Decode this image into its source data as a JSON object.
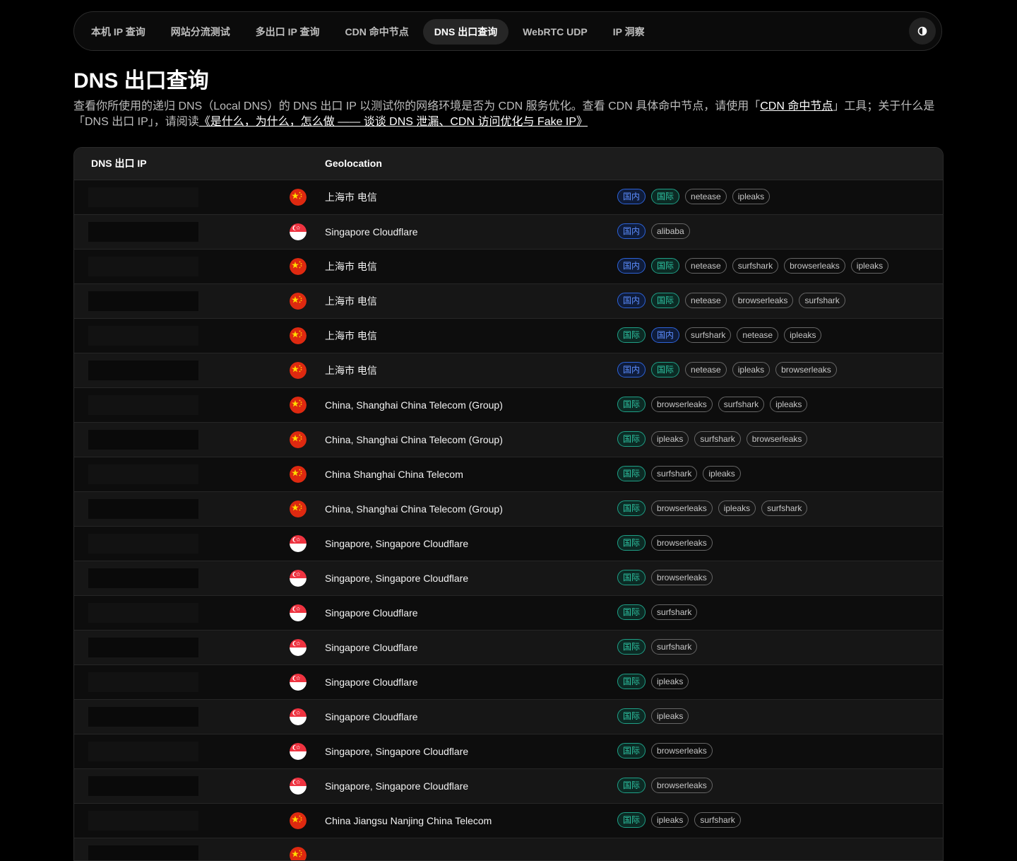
{
  "nav": {
    "tabs": [
      {
        "label": "本机 IP 查询",
        "active": false
      },
      {
        "label": "网站分流测试",
        "active": false
      },
      {
        "label": "多出口 IP 查询",
        "active": false
      },
      {
        "label": "CDN 命中节点",
        "active": false
      },
      {
        "label": "DNS 出口查询",
        "active": true
      },
      {
        "label": "WebRTC UDP",
        "active": false
      },
      {
        "label": "IP 洞察",
        "active": false
      }
    ],
    "theme_icon": "theme-toggle-icon"
  },
  "page": {
    "title": "DNS 出口查询",
    "desc_part1": "查看你所使用的递归 DNS（Local DNS）的 DNS 出口 IP 以测试你的网络环境是否为 CDN 服务优化。查看 CDN 具体命中节点，请使用「",
    "desc_link1": "CDN 命中节点",
    "desc_part2": "」工具；关于什么是「DNS 出口 IP」，请阅读",
    "desc_link2": "《是什么，为什么，怎么做 —— 谈谈 DNS 泄漏、CDN 访问优化与 Fake IP》"
  },
  "table": {
    "headers": {
      "ip": "DNS 出口 IP",
      "geo": "Geolocation"
    },
    "rows": [
      {
        "ip": "",
        "flag": "cn",
        "geo": "上海市 电信",
        "tags": [
          {
            "t": "国内",
            "k": "dom"
          },
          {
            "t": "国际",
            "k": "intl"
          },
          {
            "t": "netease",
            "k": ""
          },
          {
            "t": "ipleaks",
            "k": ""
          }
        ]
      },
      {
        "ip": "",
        "flag": "sg",
        "geo": "Singapore Cloudflare",
        "tags": [
          {
            "t": "国内",
            "k": "dom"
          },
          {
            "t": "alibaba",
            "k": ""
          }
        ]
      },
      {
        "ip": "",
        "flag": "cn",
        "geo": "上海市 电信",
        "tags": [
          {
            "t": "国内",
            "k": "dom"
          },
          {
            "t": "国际",
            "k": "intl"
          },
          {
            "t": "netease",
            "k": ""
          },
          {
            "t": "surfshark",
            "k": ""
          },
          {
            "t": "browserleaks",
            "k": ""
          },
          {
            "t": "ipleaks",
            "k": ""
          }
        ]
      },
      {
        "ip": "",
        "flag": "cn",
        "geo": "上海市 电信",
        "tags": [
          {
            "t": "国内",
            "k": "dom"
          },
          {
            "t": "国际",
            "k": "intl"
          },
          {
            "t": "netease",
            "k": ""
          },
          {
            "t": "browserleaks",
            "k": ""
          },
          {
            "t": "surfshark",
            "k": ""
          }
        ]
      },
      {
        "ip": "",
        "flag": "cn",
        "geo": "上海市 电信",
        "tags": [
          {
            "t": "国际",
            "k": "intl"
          },
          {
            "t": "国内",
            "k": "dom"
          },
          {
            "t": "surfshark",
            "k": ""
          },
          {
            "t": "netease",
            "k": ""
          },
          {
            "t": "ipleaks",
            "k": ""
          }
        ]
      },
      {
        "ip": "",
        "flag": "cn",
        "geo": "上海市 电信",
        "tags": [
          {
            "t": "国内",
            "k": "dom"
          },
          {
            "t": "国际",
            "k": "intl"
          },
          {
            "t": "netease",
            "k": ""
          },
          {
            "t": "ipleaks",
            "k": ""
          },
          {
            "t": "browserleaks",
            "k": ""
          }
        ]
      },
      {
        "ip": "",
        "flag": "cn",
        "geo": "China, Shanghai China Telecom (Group)",
        "tags": [
          {
            "t": "国际",
            "k": "intl"
          },
          {
            "t": "browserleaks",
            "k": ""
          },
          {
            "t": "surfshark",
            "k": ""
          },
          {
            "t": "ipleaks",
            "k": ""
          }
        ]
      },
      {
        "ip": "",
        "flag": "cn",
        "geo": "China, Shanghai China Telecom (Group)",
        "tags": [
          {
            "t": "国际",
            "k": "intl"
          },
          {
            "t": "ipleaks",
            "k": ""
          },
          {
            "t": "surfshark",
            "k": ""
          },
          {
            "t": "browserleaks",
            "k": ""
          }
        ]
      },
      {
        "ip": "",
        "flag": "cn",
        "geo": "China Shanghai China Telecom",
        "tags": [
          {
            "t": "国际",
            "k": "intl"
          },
          {
            "t": "surfshark",
            "k": ""
          },
          {
            "t": "ipleaks",
            "k": ""
          }
        ]
      },
      {
        "ip": "",
        "flag": "cn",
        "geo": "China, Shanghai China Telecom (Group)",
        "tags": [
          {
            "t": "国际",
            "k": "intl"
          },
          {
            "t": "browserleaks",
            "k": ""
          },
          {
            "t": "ipleaks",
            "k": ""
          },
          {
            "t": "surfshark",
            "k": ""
          }
        ]
      },
      {
        "ip": "",
        "flag": "sg",
        "geo": "Singapore, Singapore Cloudflare",
        "tags": [
          {
            "t": "国际",
            "k": "intl"
          },
          {
            "t": "browserleaks",
            "k": ""
          }
        ]
      },
      {
        "ip": "",
        "flag": "sg",
        "geo": "Singapore, Singapore Cloudflare",
        "tags": [
          {
            "t": "国际",
            "k": "intl"
          },
          {
            "t": "browserleaks",
            "k": ""
          }
        ]
      },
      {
        "ip": "",
        "flag": "sg",
        "geo": "Singapore Cloudflare",
        "tags": [
          {
            "t": "国际",
            "k": "intl"
          },
          {
            "t": "surfshark",
            "k": ""
          }
        ]
      },
      {
        "ip": "",
        "flag": "sg",
        "geo": "Singapore Cloudflare",
        "tags": [
          {
            "t": "国际",
            "k": "intl"
          },
          {
            "t": "surfshark",
            "k": ""
          }
        ]
      },
      {
        "ip": "",
        "flag": "sg",
        "geo": "Singapore Cloudflare",
        "tags": [
          {
            "t": "国际",
            "k": "intl"
          },
          {
            "t": "ipleaks",
            "k": ""
          }
        ]
      },
      {
        "ip": "",
        "flag": "sg",
        "geo": "Singapore Cloudflare",
        "tags": [
          {
            "t": "国际",
            "k": "intl"
          },
          {
            "t": "ipleaks",
            "k": ""
          }
        ]
      },
      {
        "ip": "",
        "flag": "sg",
        "geo": "Singapore, Singapore Cloudflare",
        "tags": [
          {
            "t": "国际",
            "k": "intl"
          },
          {
            "t": "browserleaks",
            "k": ""
          }
        ]
      },
      {
        "ip": "",
        "flag": "sg",
        "geo": "Singapore, Singapore Cloudflare",
        "tags": [
          {
            "t": "国际",
            "k": "intl"
          },
          {
            "t": "browserleaks",
            "k": ""
          }
        ]
      },
      {
        "ip": "",
        "flag": "cn",
        "geo": "China Jiangsu Nanjing China Telecom",
        "tags": [
          {
            "t": "国际",
            "k": "intl"
          },
          {
            "t": "ipleaks",
            "k": ""
          },
          {
            "t": "surfshark",
            "k": ""
          }
        ]
      },
      {
        "ip": "",
        "flag": "cn",
        "geo": "",
        "tags": []
      }
    ]
  }
}
